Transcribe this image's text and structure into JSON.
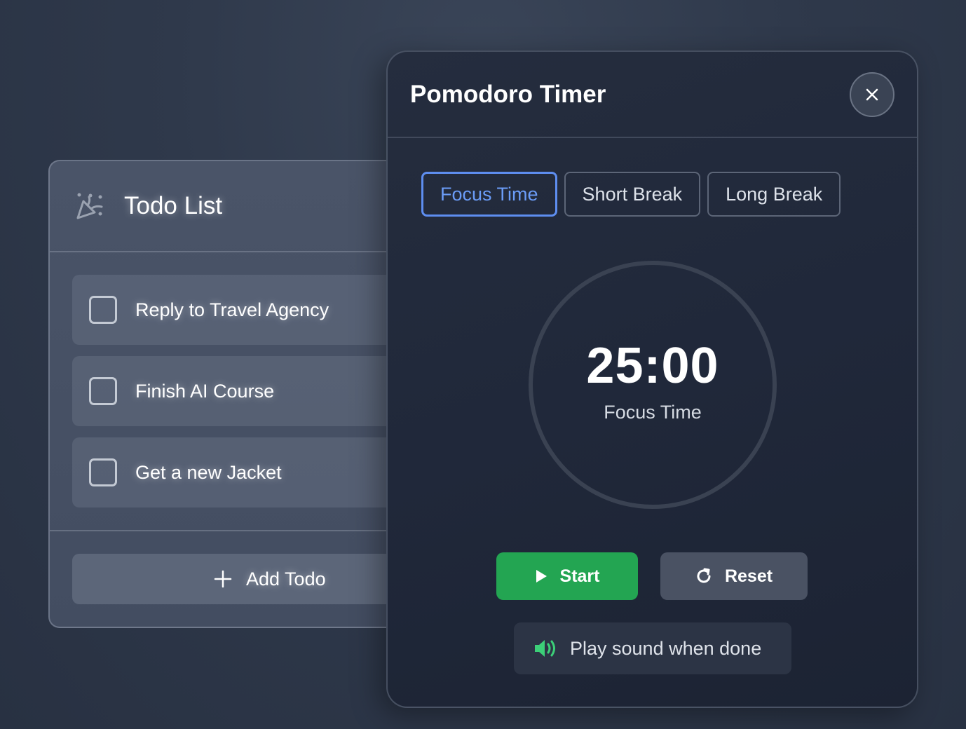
{
  "todo": {
    "title": "Todo List",
    "items": [
      {
        "label": "Reply to Travel Agency",
        "checked": false
      },
      {
        "label": "Finish AI Course",
        "checked": false
      },
      {
        "label": "Get a new Jacket",
        "checked": false
      }
    ],
    "add_label": "Add Todo",
    "icons": {
      "header": "party-popper-icon",
      "add": "plus-icon"
    }
  },
  "pomodoro": {
    "title": "Pomodoro Timer",
    "tabs": [
      {
        "label": "Focus Time",
        "active": true
      },
      {
        "label": "Short Break",
        "active": false
      },
      {
        "label": "Long Break",
        "active": false
      }
    ],
    "timer": {
      "time": "25:00",
      "mode_label": "Focus Time"
    },
    "start_label": "Start",
    "reset_label": "Reset",
    "sound_label": "Play sound when done",
    "colors": {
      "accent": "#5e8ef0",
      "start": "#23a552",
      "sound_icon": "#3ccf78"
    }
  }
}
